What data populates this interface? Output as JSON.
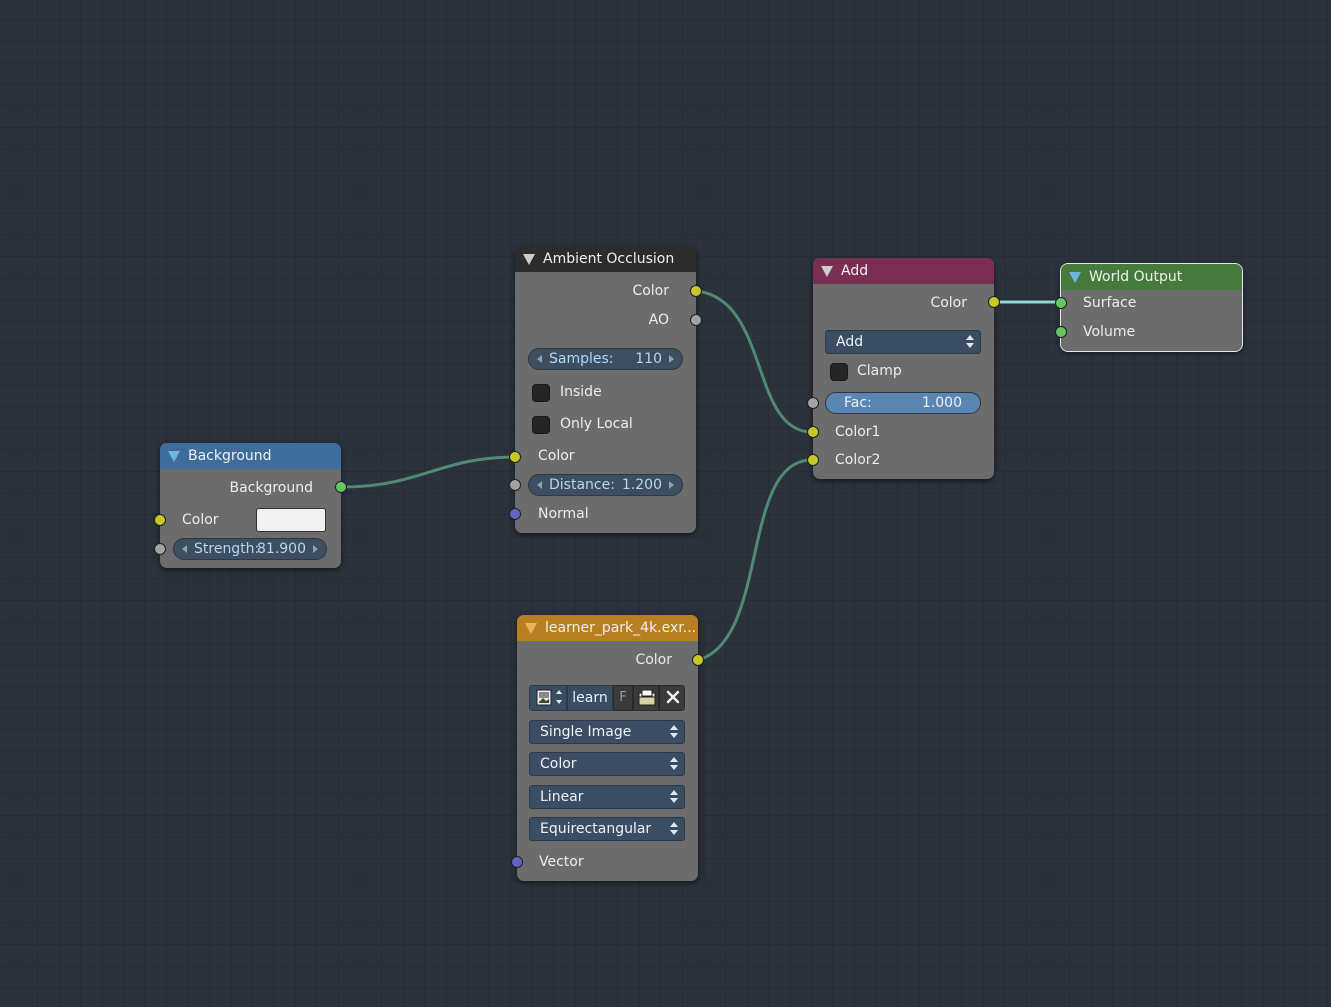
{
  "nodes": {
    "background": {
      "title": "Background",
      "output_label": "Background",
      "color_label": "Color",
      "color_value": "#f2f2f2",
      "strength_label": "Strength:",
      "strength_value": "81.900"
    },
    "ambient_occlusion": {
      "title": "Ambient Occlusion",
      "out_color_label": "Color",
      "out_ao_label": "AO",
      "samples_label": "Samples:",
      "samples_value": "110",
      "inside_label": "Inside",
      "inside_checked": false,
      "only_local_label": "Only Local",
      "only_local_checked": false,
      "in_color_label": "Color",
      "distance_label": "Distance:",
      "distance_value": "1.200",
      "normal_label": "Normal"
    },
    "add": {
      "title": "Add",
      "out_color_label": "Color",
      "operation_value": "Add",
      "clamp_label": "Clamp",
      "clamp_checked": false,
      "fac_label": "Fac:",
      "fac_value": "1.000",
      "color1_label": "Color1",
      "color2_label": "Color2"
    },
    "world_output": {
      "title": "World Output",
      "surface_label": "Surface",
      "volume_label": "Volume"
    },
    "image_texture": {
      "title": "learner_park_4k.exr...",
      "out_color_label": "Color",
      "image_name": "learn",
      "fake_user_label": "F",
      "projection_value": "Single Image",
      "color_space_value": "Color",
      "interpolation_value": "Linear",
      "mapping_value": "Equirectangular",
      "vector_label": "Vector"
    }
  },
  "colors": {
    "socket_color": "#c7c729",
    "socket_shader": "#63c763",
    "socket_value": "#a3a3a3",
    "socket_vector": "#6363c7",
    "link": "#5aa07e",
    "header_input": "#3e6d9c",
    "header_shader": "#2a5a2a",
    "header_texture": "#b87f21",
    "header_color": "#7a2f52",
    "header_output": "#467a3c",
    "header_ao": "#2c2c2c"
  }
}
